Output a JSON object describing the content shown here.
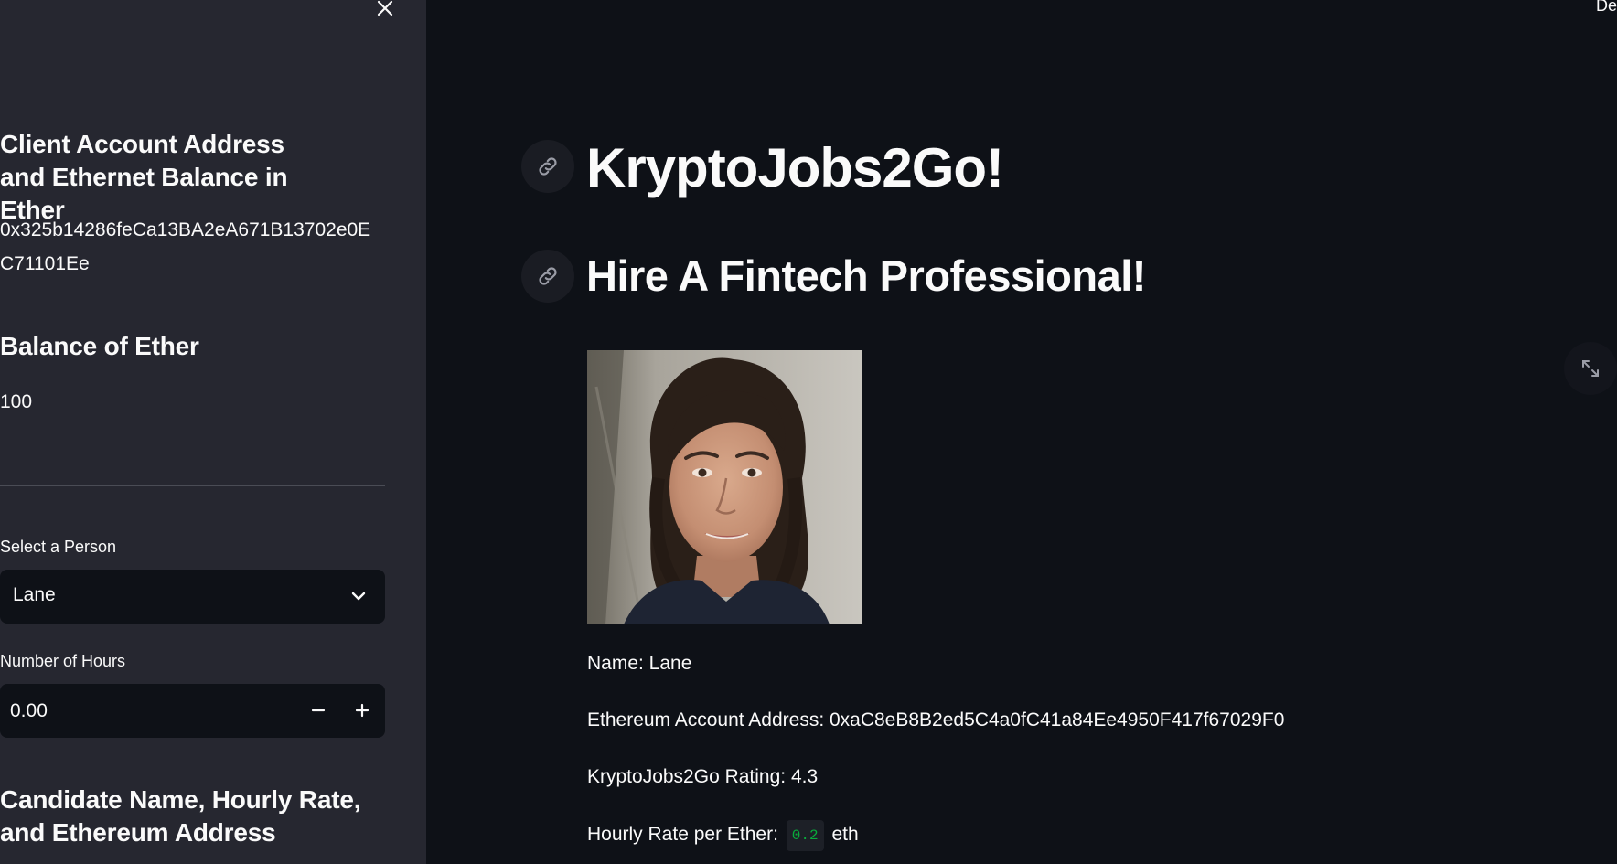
{
  "sidebar": {
    "account_heading": "Client Account Address and Ethernet Balance in Ether",
    "account_address_line1": "0x325b14286feCa13BA2eA671B13702e0E",
    "account_address_line2": "C71101Ee",
    "balance_heading": "Balance of Ether",
    "balance_value": "100",
    "select_label": "Select a Person",
    "select_value": "Lane",
    "hours_label": "Number of Hours",
    "hours_value": "0.00",
    "candidate_heading": "Candidate Name, Hourly Rate, and Ethereum Address"
  },
  "header": {
    "top_right_text": "De"
  },
  "main": {
    "title": "KryptoJobs2Go!",
    "subtitle": "Hire A Fintech Professional!",
    "name_line": "Name: Lane",
    "address_line": "Ethereum Account Address: 0xaC8eB8B2ed5C4a0fC41a84Ee4950F417f67029F0",
    "rating_line": "KryptoJobs2Go Rating: 4.3",
    "rate_prefix": "Hourly Rate per Ether:",
    "rate_value": "0.2",
    "rate_suffix": "eth"
  },
  "icons": {
    "close": "close-icon",
    "chevron": "chevron-down-icon",
    "link": "link-icon",
    "fullscreen": "fullscreen-icon"
  },
  "colors": {
    "sidebar_bg": "#262730",
    "main_bg": "#0e1117",
    "code_green": "#09ab3b"
  }
}
